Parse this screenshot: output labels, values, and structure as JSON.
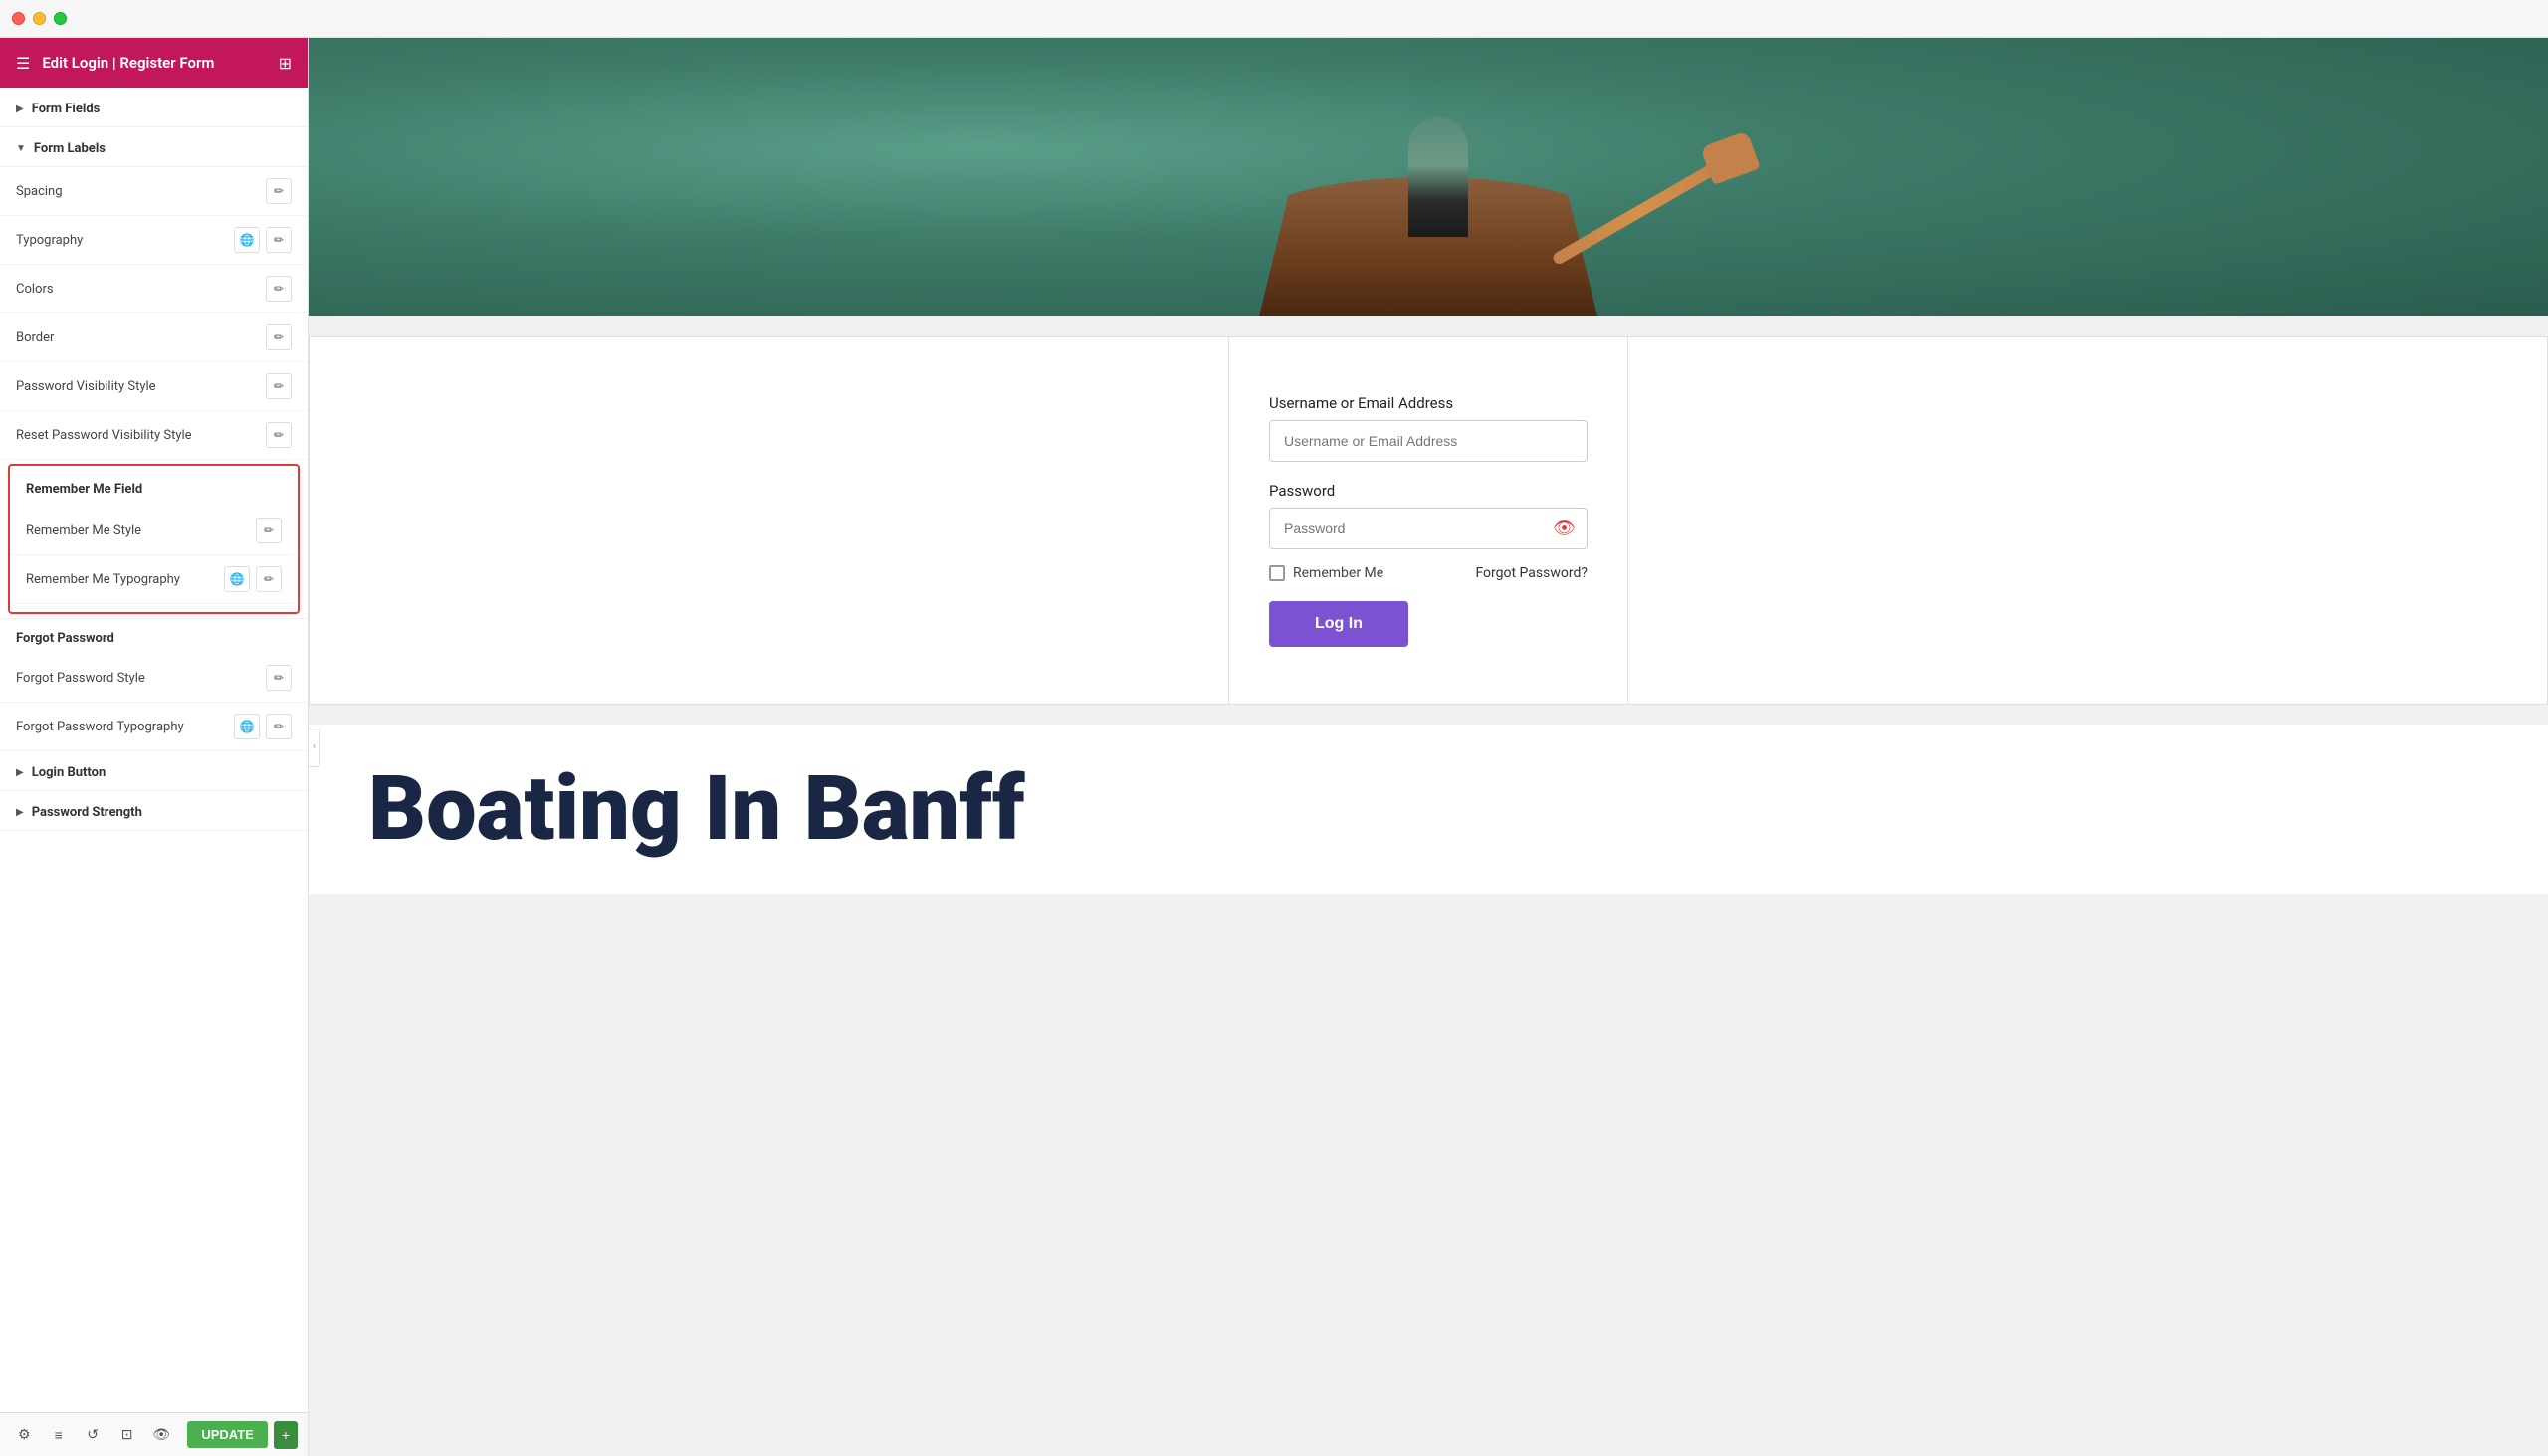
{
  "titlebar": {
    "traffic_lights": [
      "red",
      "yellow",
      "green"
    ]
  },
  "sidebar": {
    "title": "Edit Login | Register Form",
    "sections": [
      {
        "id": "form-fields",
        "label": "Form Fields",
        "collapsed": true,
        "arrow": "▶"
      },
      {
        "id": "form-labels",
        "label": "Form Labels",
        "collapsed": false,
        "arrow": "▼",
        "rows": [
          {
            "id": "spacing",
            "label": "Spacing",
            "icons": [
              "edit"
            ]
          },
          {
            "id": "typography",
            "label": "Typography",
            "icons": [
              "globe",
              "edit"
            ]
          },
          {
            "id": "colors",
            "label": "Colors",
            "icons": [
              "edit"
            ]
          },
          {
            "id": "border",
            "label": "Border",
            "icons": [
              "edit"
            ]
          },
          {
            "id": "password-visibility-style",
            "label": "Password Visibility Style",
            "icons": [
              "edit"
            ]
          },
          {
            "id": "reset-password-visibility-style",
            "label": "Reset Password Visibility Style",
            "icons": [
              "edit"
            ]
          }
        ]
      }
    ],
    "remember_me_field": {
      "header": "Remember Me Field",
      "rows": [
        {
          "id": "remember-me-style",
          "label": "Remember Me Style",
          "icons": [
            "edit"
          ]
        },
        {
          "id": "remember-me-typography",
          "label": "Remember Me Typography",
          "icons": [
            "globe",
            "edit"
          ]
        }
      ]
    },
    "forgot_password": {
      "header": "Forgot Password",
      "rows": [
        {
          "id": "forgot-password-style",
          "label": "Forgot Password Style",
          "icons": [
            "edit"
          ]
        },
        {
          "id": "forgot-password-typography",
          "label": "Forgot Password Typography",
          "icons": [
            "globe",
            "edit"
          ]
        }
      ]
    },
    "login_button": {
      "label": "Login Button",
      "collapsed": true,
      "arrow": "▶"
    },
    "password_strength": {
      "label": "Password Strength",
      "collapsed": true,
      "arrow": "▶"
    }
  },
  "toolbar": {
    "update_label": "UPDATE",
    "plus_label": "+"
  },
  "main": {
    "login_form": {
      "username_label": "Username or Email Address",
      "username_placeholder": "Username or Email Address",
      "password_label": "Password",
      "password_placeholder": "Password",
      "remember_me_label": "Remember Me",
      "forgot_password_label": "Forgot Password?",
      "login_button_label": "Log In"
    },
    "boating_title": "Boating In Banff"
  }
}
